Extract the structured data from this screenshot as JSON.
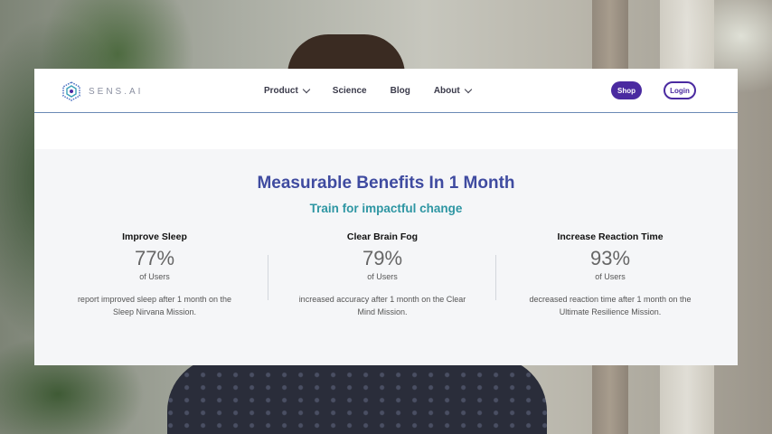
{
  "brand": {
    "name": "SENS.AI",
    "accent": "#4a2aa0"
  },
  "nav": {
    "product": "Product",
    "science": "Science",
    "blog": "Blog",
    "about": "About"
  },
  "actions": {
    "shop": "Shop",
    "login": "Login"
  },
  "section": {
    "headline": "Measurable Benefits In 1 Month",
    "subhead": "Train for impactful change",
    "stats": [
      {
        "title": "Improve Sleep",
        "pct": "77%",
        "unit": "of Users",
        "desc_line1": "report improved sleep after 1 month on the",
        "desc_line2": "Sleep Nirvana Mission."
      },
      {
        "title": "Clear Brain Fog",
        "pct": "79%",
        "unit": "of Users",
        "desc_line1": "increased accuracy after 1 month on the Clear",
        "desc_line2": "Mind Mission."
      },
      {
        "title": "Increase Reaction Time",
        "pct": "93%",
        "unit": "of Users",
        "desc_line1": "decreased reaction time after 1 month on the",
        "desc_line2": "Ultimate Resilience Mission."
      }
    ]
  },
  "colors": {
    "headline": "#3f4ba0",
    "subhead": "#2e96a3",
    "button": "#4a2aa0"
  }
}
